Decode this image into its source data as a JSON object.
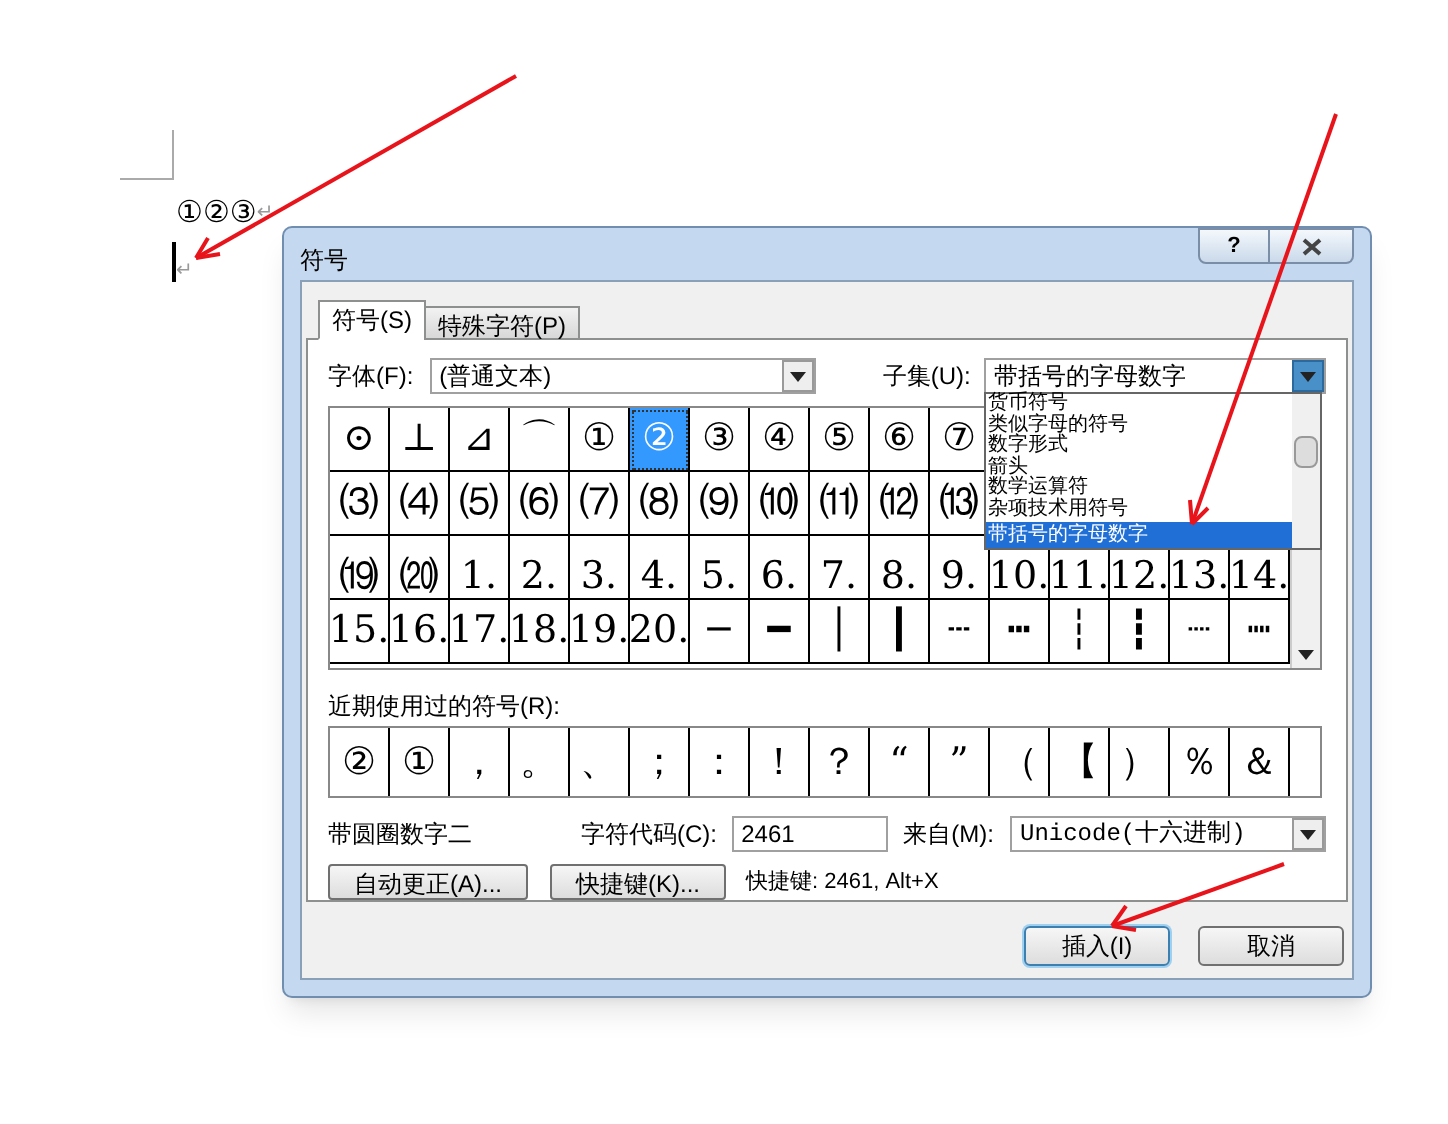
{
  "document": {
    "line": "①②③",
    "paragraph_mark": "↵",
    "cursor_mark": "↵"
  },
  "dialog": {
    "title": "符号",
    "help": "?",
    "tabs": [
      {
        "label": "符号(S)",
        "selected": true
      },
      {
        "label": "特殊字符(P)",
        "selected": false
      }
    ],
    "font_label": "字体(F):",
    "font_value": "(普通文本)",
    "subset_label": "子集(U):",
    "subset_value": "带括号的字母数字",
    "subset_options": [
      {
        "label": "货币符号",
        "selected": false
      },
      {
        "label": "类似字母的符号",
        "selected": false
      },
      {
        "label": "数字形式",
        "selected": false
      },
      {
        "label": "箭头",
        "selected": false
      },
      {
        "label": "数学运算符",
        "selected": false
      },
      {
        "label": "杂项技术用符号",
        "selected": false
      },
      {
        "label": "带括号的字母数字",
        "selected": true
      }
    ],
    "grid": [
      [
        {
          "char": "⊙",
          "selected": false
        },
        {
          "char": "⊥",
          "selected": false
        },
        {
          "char": "⊿",
          "selected": false
        },
        {
          "char": "⌒",
          "selected": false
        },
        {
          "char": "①",
          "selected": false
        },
        {
          "char": "②",
          "selected": true
        },
        {
          "char": "③",
          "selected": false
        },
        {
          "char": "④",
          "selected": false
        },
        {
          "char": "⑤",
          "selected": false
        },
        {
          "char": "⑥",
          "selected": false
        },
        {
          "char": "⑦",
          "selected": false
        }
      ],
      [
        {
          "char": "⑶",
          "selected": false
        },
        {
          "char": "⑷",
          "selected": false
        },
        {
          "char": "⑸",
          "selected": false
        },
        {
          "char": "⑹",
          "selected": false
        },
        {
          "char": "⑺",
          "selected": false
        },
        {
          "char": "⑻",
          "selected": false
        },
        {
          "char": "⑼",
          "selected": false
        },
        {
          "char": "⑽",
          "selected": false
        },
        {
          "char": "⑾",
          "selected": false
        },
        {
          "char": "⑿",
          "selected": false
        },
        {
          "char": "⒀",
          "selected": false
        }
      ],
      [
        {
          "char": "⒆",
          "selected": false
        },
        {
          "char": "⒇",
          "selected": false
        },
        {
          "char": "1.",
          "selected": false
        },
        {
          "char": "2.",
          "selected": false
        },
        {
          "char": "3.",
          "selected": false
        },
        {
          "char": "4.",
          "selected": false
        },
        {
          "char": "5.",
          "selected": false
        },
        {
          "char": "6.",
          "selected": false
        },
        {
          "char": "7.",
          "selected": false
        },
        {
          "char": "8.",
          "selected": false
        },
        {
          "char": "9.",
          "selected": false
        },
        {
          "char": "10.",
          "selected": false
        },
        {
          "char": "11.",
          "selected": false
        },
        {
          "char": "12.",
          "selected": false
        },
        {
          "char": "13.",
          "selected": false
        },
        {
          "char": "14.",
          "selected": false
        }
      ],
      [
        {
          "char": "15.",
          "selected": false
        },
        {
          "char": "16.",
          "selected": false
        },
        {
          "char": "17.",
          "selected": false
        },
        {
          "char": "18.",
          "selected": false
        },
        {
          "char": "19.",
          "selected": false
        },
        {
          "char": "20.",
          "selected": false
        },
        {
          "char": "─",
          "selected": false
        },
        {
          "char": "━",
          "selected": false
        },
        {
          "char": "│",
          "selected": false
        },
        {
          "char": "┃",
          "selected": false
        },
        {
          "char": "┄",
          "selected": false
        },
        {
          "char": "┅",
          "selected": false
        },
        {
          "char": "┆",
          "selected": false
        },
        {
          "char": "┇",
          "selected": false
        },
        {
          "char": "┈",
          "selected": false
        },
        {
          "char": "┉",
          "selected": false
        }
      ]
    ],
    "recent_label": "近期使用过的符号(R):",
    "recent": [
      "②",
      "①",
      "，",
      "。",
      "、",
      "；",
      "：",
      "！",
      "？",
      "“",
      "”",
      "（",
      "【",
      "）",
      "％",
      "＆"
    ],
    "char_name": "带圆圈数字二",
    "code_label": "字符代码(C):",
    "code_value": "2461",
    "from_label": "来自(M):",
    "from_value": "Unicode(十六进制)",
    "autocorrect_button": "自动更正(A)...",
    "shortcut_button": "快捷键(K)...",
    "shortcut_info": "快捷键: 2461, Alt+X",
    "footer_buttons": [
      {
        "label": "插入(I)",
        "default": true
      },
      {
        "label": "取消",
        "default": false
      }
    ]
  }
}
